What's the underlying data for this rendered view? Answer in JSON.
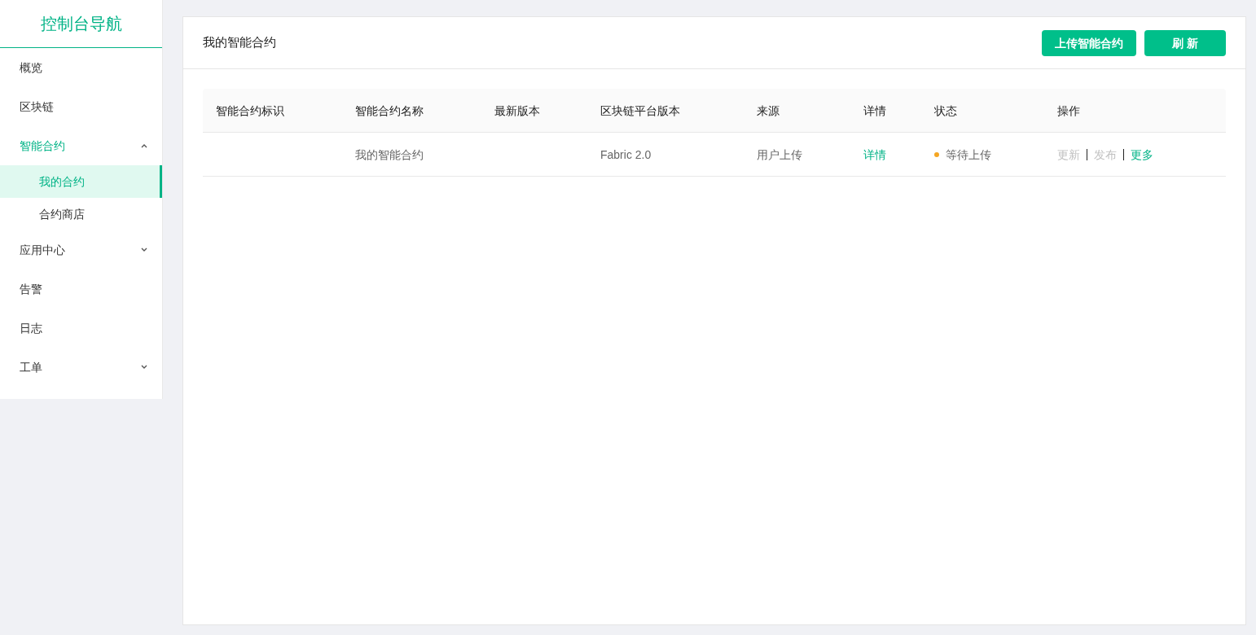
{
  "sidebar": {
    "title": "控制台导航",
    "items": [
      {
        "label": "概览",
        "selected": false
      },
      {
        "label": "区块链",
        "selected": false
      },
      {
        "label": "智能合约",
        "selected": true,
        "expanded": true,
        "children": [
          {
            "label": "我的合约",
            "selected": true
          },
          {
            "label": "合约商店",
            "selected": false
          }
        ]
      },
      {
        "label": "应用中心",
        "selected": false,
        "expanded": false
      },
      {
        "label": "告警",
        "selected": false
      },
      {
        "label": "日志",
        "selected": false
      },
      {
        "label": "工单",
        "selected": false,
        "expanded": false
      }
    ]
  },
  "page": {
    "title": "我的智能合约",
    "buttons": [
      "上传智能合约",
      "刷 新"
    ]
  },
  "table": {
    "columns": [
      "智能合约标识",
      "智能合约名称",
      "最新版本",
      "区块链平台版本",
      "来源",
      "详情",
      "状态",
      "操作"
    ],
    "rows": [
      {
        "id": "",
        "name": "我的智能合约",
        "version": "",
        "platform": "Fabric 2.0",
        "source": "用户上传",
        "detail": "详情",
        "status": {
          "label": "等待上传",
          "color": "#f5a623"
        },
        "actions": [
          {
            "label": "更新",
            "disabled": true
          },
          {
            "label": "发布",
            "disabled": true
          },
          {
            "label": "更多",
            "disabled": false
          }
        ]
      }
    ]
  }
}
